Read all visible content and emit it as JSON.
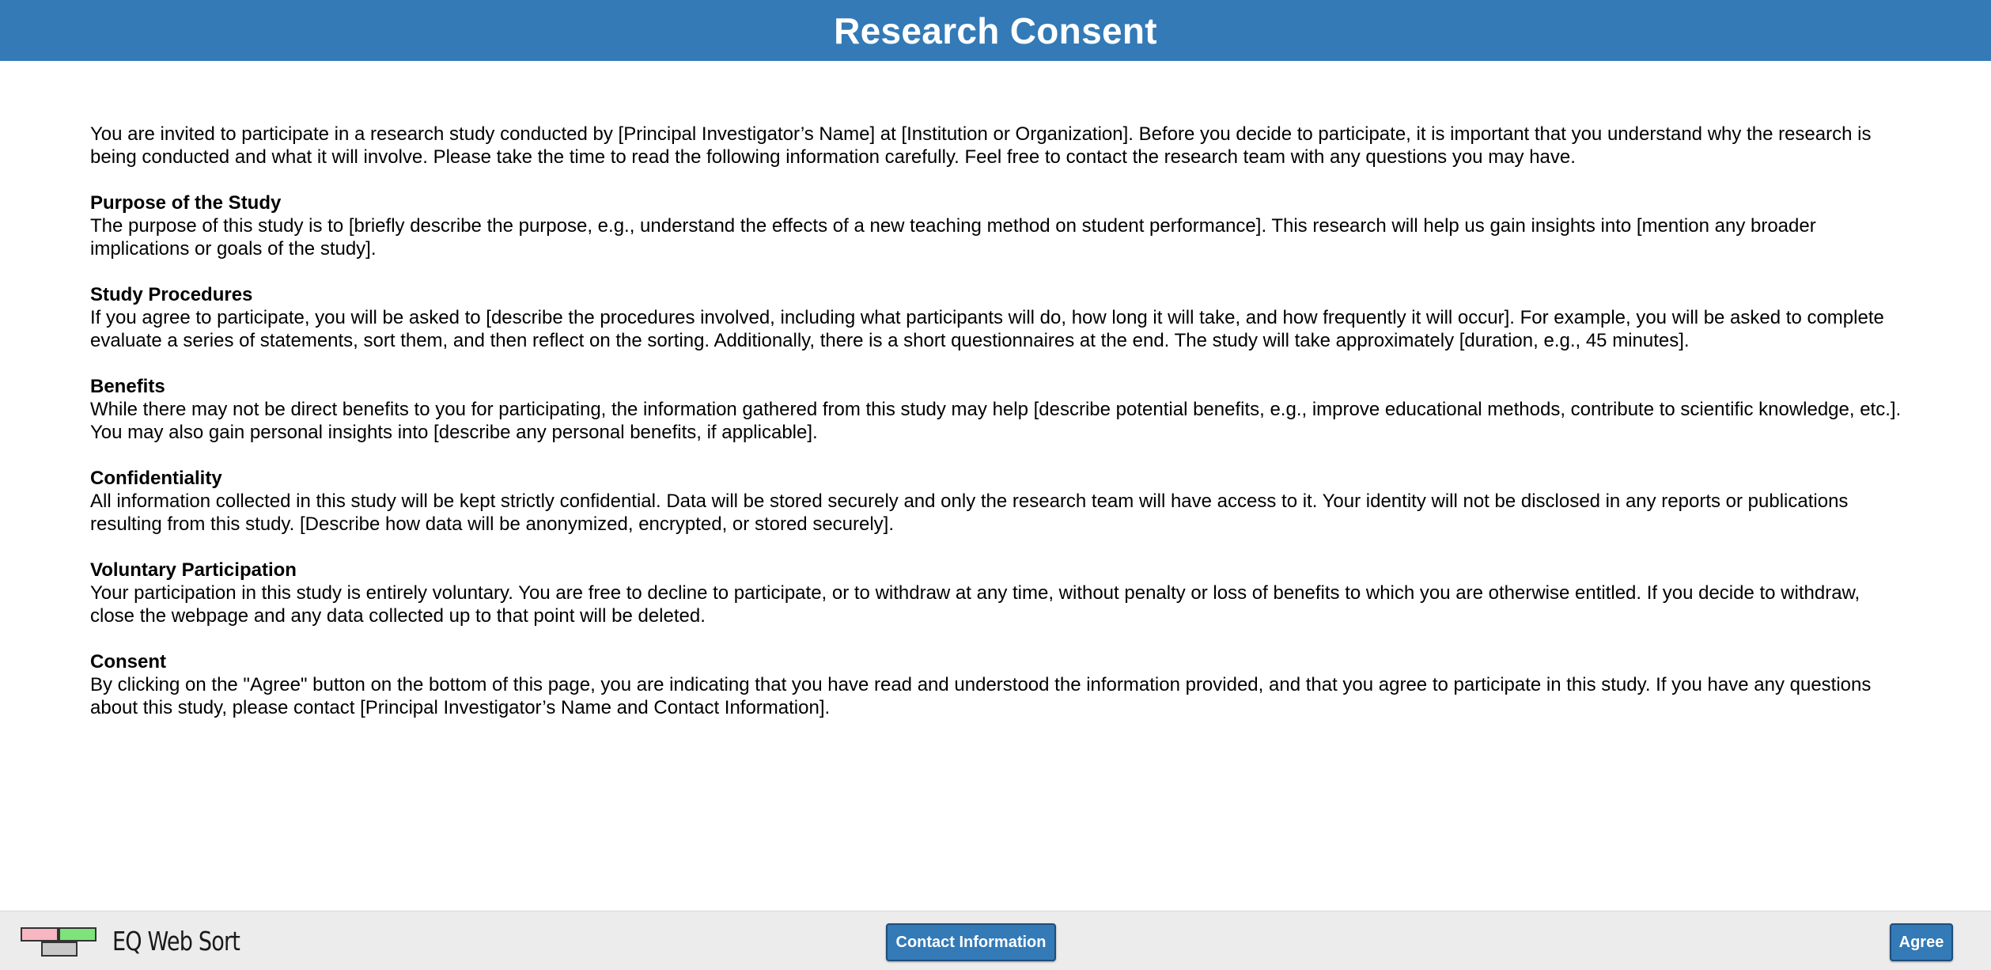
{
  "header": {
    "title": "Research Consent"
  },
  "intro": "You are invited to participate in a research study conducted by [Principal Investigator’s Name] at [Institution or Organization]. Before you decide to participate, it is important that you understand why the research is being conducted and what it will involve. Please take the time to read the following information carefully. Feel free to contact the research team with any questions you may have.",
  "sections": [
    {
      "title": "Purpose of the Study",
      "body": "The purpose of this study is to [briefly describe the purpose, e.g., understand the effects of a new teaching method on student performance]. This research will help us gain insights into [mention any broader implications or goals of the study]."
    },
    {
      "title": "Study Procedures",
      "body": "If you agree to participate, you will be asked to [describe the procedures involved, including what participants will do, how long it will take, and how frequently it will occur]. For example, you will be asked to complete evaluate a series of statements, sort them, and then reflect on the sorting. Additionally, there is a short questionnaires at the end. The study will take approximately [duration, e.g., 45 minutes]."
    },
    {
      "title": "Benefits",
      "body": "While there may not be direct benefits to you for participating, the information gathered from this study may help [describe potential benefits, e.g., improve educational methods, contribute to scientific knowledge, etc.]. You may also gain personal insights into [describe any personal benefits, if applicable]."
    },
    {
      "title": "Confidentiality",
      "body": "All information collected in this study will be kept strictly confidential. Data will be stored securely and only the research team will have access to it. Your identity will not be disclosed in any reports or publications resulting from this study. [Describe how data will be anonymized, encrypted, or stored securely]."
    },
    {
      "title": "Voluntary Participation",
      "body": "Your participation in this study is entirely voluntary. You are free to decline to participate, or to withdraw at any time, without penalty or loss of benefits to which you are otherwise entitled. If you decide to withdraw, close the webpage and any data collected up to that point will be deleted."
    },
    {
      "title": "Consent",
      "body": "By clicking on the \"Agree\" button on the bottom of this page, you are indicating that you have read and understood the information provided, and that you agree to participate in this study. If you have any questions about this study, please contact [Principal Investigator’s Name and Contact Information]."
    }
  ],
  "footer": {
    "brand": "EQ Web Sort",
    "contact_label": "Contact Information",
    "agree_label": "Agree"
  },
  "colors": {
    "header_bg": "#337ab7",
    "button_bg": "#337ab7",
    "footer_bg": "#ececec"
  }
}
